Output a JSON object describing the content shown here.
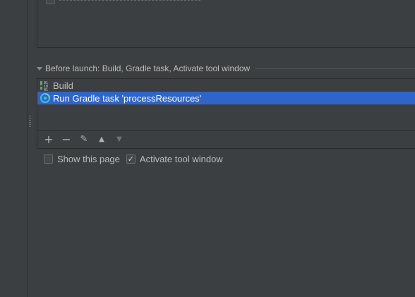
{
  "before_launch": {
    "title": "Before launch: Build, Gradle task, Activate tool window",
    "tasks": [
      {
        "label": "Build",
        "icon": "build-icon",
        "selected": false
      },
      {
        "label": "Run Gradle task 'processResources'",
        "icon": "gradle-icon",
        "selected": true
      }
    ],
    "toolbar": {
      "add": "+",
      "remove": "−",
      "edit": "✎",
      "up": "▲",
      "down": "▼"
    }
  },
  "options": {
    "show_this_page": {
      "label": "Show this page",
      "checked": false
    },
    "activate_tool_window": {
      "label": "Activate tool window",
      "checked": true
    }
  },
  "colors": {
    "background": "#3c3f41",
    "selection": "#2f65ca",
    "text": "#bbbbbb",
    "border": "#2b2b2b"
  }
}
